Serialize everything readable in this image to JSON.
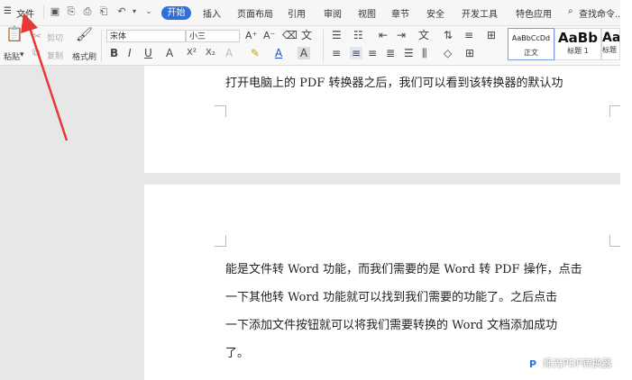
{
  "menubar": {
    "menu_label": "文件",
    "tabs": [
      {
        "label": "开始",
        "active": true
      },
      {
        "label": "插入"
      },
      {
        "label": "页面布局"
      },
      {
        "label": "引用"
      },
      {
        "label": "审阅"
      },
      {
        "label": "视图"
      },
      {
        "label": "章节"
      },
      {
        "label": "安全"
      },
      {
        "label": "开发工具"
      },
      {
        "label": "特色应用"
      }
    ],
    "search_label": "查找命令..."
  },
  "ribbon": {
    "paste": "粘贴",
    "cut": "剪切",
    "copy": "复制",
    "format_painter": "格式刷",
    "font_name": "宋体",
    "font_size": "小三",
    "bold": "B",
    "italic": "I",
    "underline": "U",
    "font_color_a": "A",
    "superscript": "X²",
    "subscript": "X₂",
    "grow_font": "A⁺",
    "shrink_font": "A⁻",
    "styles": [
      {
        "preview": "AaBbCcDd",
        "label": "正文"
      },
      {
        "preview": "AaBb",
        "label": "标题 1"
      },
      {
        "preview": "AaB",
        "label": "标题"
      }
    ]
  },
  "document": {
    "page1_line": "打开电脑上的 PDF 转换器之后，我们可以看到该转换器的默认功",
    "page2_lines": [
      "能是文件转 Word 功能，而我们需要的是 Word 转 PDF 操作，点击",
      "一下其他转 Word 功能就可以找到我们需要的功能了。之后点击",
      "一下添加文件按钮就可以将我们需要转换的 Word 文档添加成功",
      "了。"
    ]
  },
  "watermark": "烁光PDF转换器",
  "colors": {
    "accent": "#2f6fd8",
    "arrow": "#e53935",
    "canvas": "#e7e7e7"
  }
}
